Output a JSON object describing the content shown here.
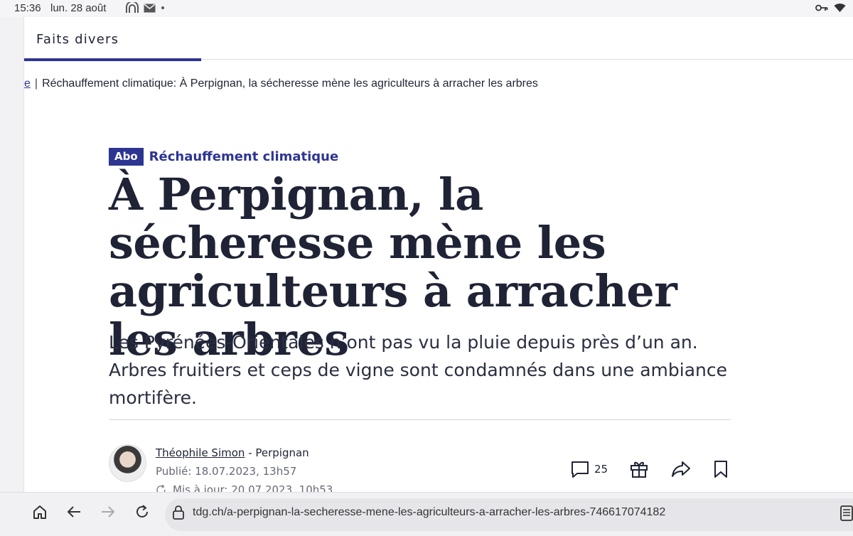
{
  "status_bar": {
    "time": "15:36",
    "date": "lun. 28 août"
  },
  "section_nav": {
    "title": "Faits divers"
  },
  "breadcrumb": {
    "previous": "e",
    "separator": "|",
    "current": "Réchauffement climatique: À Perpignan, la sécheresse mène les agriculteurs à arracher les arbres"
  },
  "article": {
    "badge": "Abo",
    "kicker": "Réchauffement climatique",
    "headline": "À Perpignan, la sécheresse mène les agriculteurs à arracher les arbres",
    "lede": "Les Pyrénées-Orientales n’ont pas vu la pluie depuis près d’un an. Arbres fruitiers et ceps de vigne sont condamnés dans une ambiance mortifère.",
    "author": {
      "name": "Théophile Simon",
      "location": " - Perpignan",
      "published": "Publié: 18.07.2023, 13h57",
      "updated": "Mis à jour: 20.07.2023, 10h53"
    },
    "actions": {
      "comment_count": "25"
    }
  },
  "browser": {
    "url": "tdg.ch/a-perpignan-la-secheresse-mene-les-agriculteurs-a-arracher-les-arbres-746617074182"
  },
  "colors": {
    "accent": "#2d3592",
    "text": "#1f2335"
  }
}
